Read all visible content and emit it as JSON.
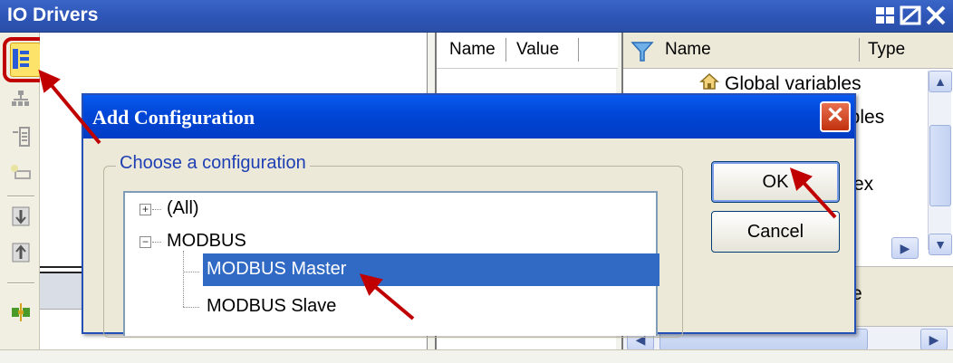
{
  "window": {
    "title": "IO Drivers",
    "controls": [
      "tile-icon",
      "restore-icon",
      "close-icon"
    ]
  },
  "toolbar": {
    "buttons": [
      {
        "name": "add-configuration-icon",
        "highlighted": true
      },
      {
        "name": "network-tree-icon"
      },
      {
        "name": "insert-device-icon"
      },
      {
        "name": "add-channel-icon"
      },
      {
        "name": "move-down-icon"
      },
      {
        "name": "move-up-icon"
      },
      {
        "name": "link-icon"
      }
    ]
  },
  "properties": {
    "col_name": "Name",
    "col_value": "Value"
  },
  "variables": {
    "col_name": "Name",
    "col_type": "Type",
    "rows": [
      {
        "label": "Global variables"
      },
      {
        "label": "ables"
      },
      {
        "label": "ex"
      }
    ],
    "lower_label": "e"
  },
  "dialog": {
    "title": "Add Configuration",
    "group_label": "Choose a configuration",
    "tree": [
      {
        "label": "(All)",
        "expander": "+",
        "indent": 0
      },
      {
        "label": "MODBUS",
        "expander": "−",
        "indent": 0
      },
      {
        "label": "MODBUS Master",
        "indent": 1,
        "selected": true
      },
      {
        "label": "MODBUS Slave",
        "indent": 1
      }
    ],
    "ok_label": "OK",
    "cancel_label": "Cancel"
  },
  "colors": {
    "title_bar": "#2e56b8",
    "dialog_title": "#0047d8",
    "selection": "#316ac5",
    "annotation_red": "#c00000"
  }
}
